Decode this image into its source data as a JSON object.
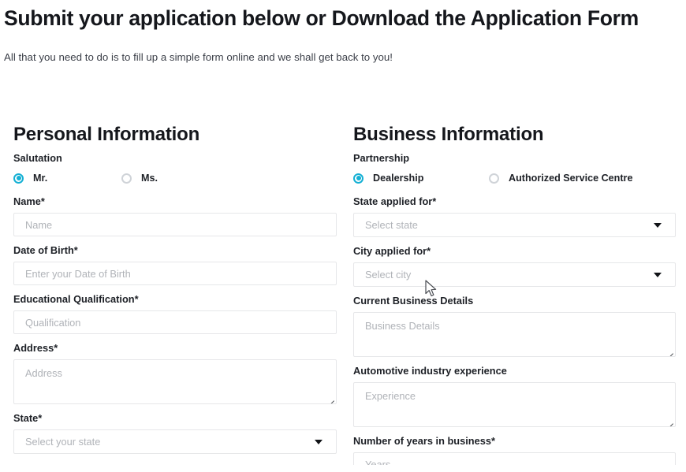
{
  "header": {
    "title": "Submit your application below or Download the Application Form",
    "subtitle": "All that you need to do is to fill up a simple form online and we shall get back to you!"
  },
  "theme": {
    "accent": "#15b0d4",
    "text": "#15171c",
    "placeholder": "#b0b3b8",
    "border": "#e6e7e9",
    "background": "#ffffff"
  },
  "personal": {
    "section_title": "Personal Information",
    "salutation": {
      "label": "Salutation",
      "options": [
        {
          "label": "Mr.",
          "selected": true
        },
        {
          "label": "Ms.",
          "selected": false
        }
      ]
    },
    "name": {
      "label": "Name*",
      "placeholder": "Name",
      "value": ""
    },
    "dob": {
      "label": "Date of Birth*",
      "placeholder": "Enter your Date of Birth",
      "value": ""
    },
    "qualification": {
      "label": "Educational Qualification*",
      "placeholder": "Qualification",
      "value": ""
    },
    "address": {
      "label": "Address*",
      "placeholder": "Address",
      "value": ""
    },
    "state": {
      "label": "State*",
      "placeholder": "Select your state",
      "value": ""
    }
  },
  "business": {
    "section_title": "Business Information",
    "partnership": {
      "label": "Partnership",
      "options": [
        {
          "label": "Dealership",
          "selected": true
        },
        {
          "label": "Authorized Service Centre",
          "selected": false
        }
      ]
    },
    "state_applied": {
      "label": "State applied for*",
      "placeholder": "Select state",
      "value": ""
    },
    "city_applied": {
      "label": "City applied for*",
      "placeholder": "Select city",
      "value": ""
    },
    "current_business": {
      "label": "Current Business Details",
      "placeholder": "Business Details",
      "value": ""
    },
    "automotive_experience": {
      "label": "Automotive industry experience",
      "placeholder": "Experience",
      "value": ""
    },
    "years_in_business": {
      "label": "Number of years in business*",
      "placeholder": "Years",
      "value": ""
    }
  }
}
